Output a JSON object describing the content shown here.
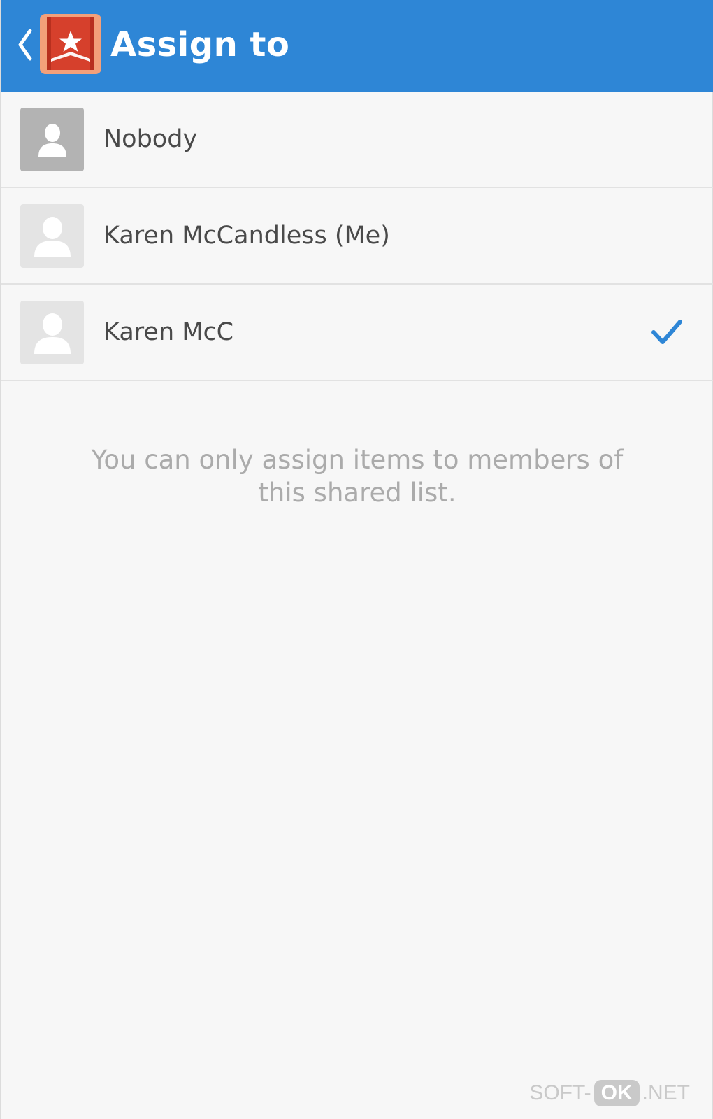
{
  "header": {
    "title": "Assign to",
    "back_icon": "chevron-left-icon",
    "logo_icon": "wunderlist-bookmark-star-icon",
    "background_color": "#2e86d6"
  },
  "assignees": [
    {
      "name": "Nobody",
      "avatar_icon": "person-placeholder-icon",
      "selected": false
    },
    {
      "name": "Karen McCandless (Me)",
      "avatar_icon": "person-placeholder-icon",
      "selected": false
    },
    {
      "name": "Karen McC",
      "avatar_icon": "person-placeholder-icon",
      "selected": true
    }
  ],
  "info_text": "You can only assign items to members of this shared list.",
  "selection_color": "#2e86d6",
  "watermark": {
    "prefix": "SOFT-",
    "badge": "OK",
    "suffix": ".NET"
  }
}
